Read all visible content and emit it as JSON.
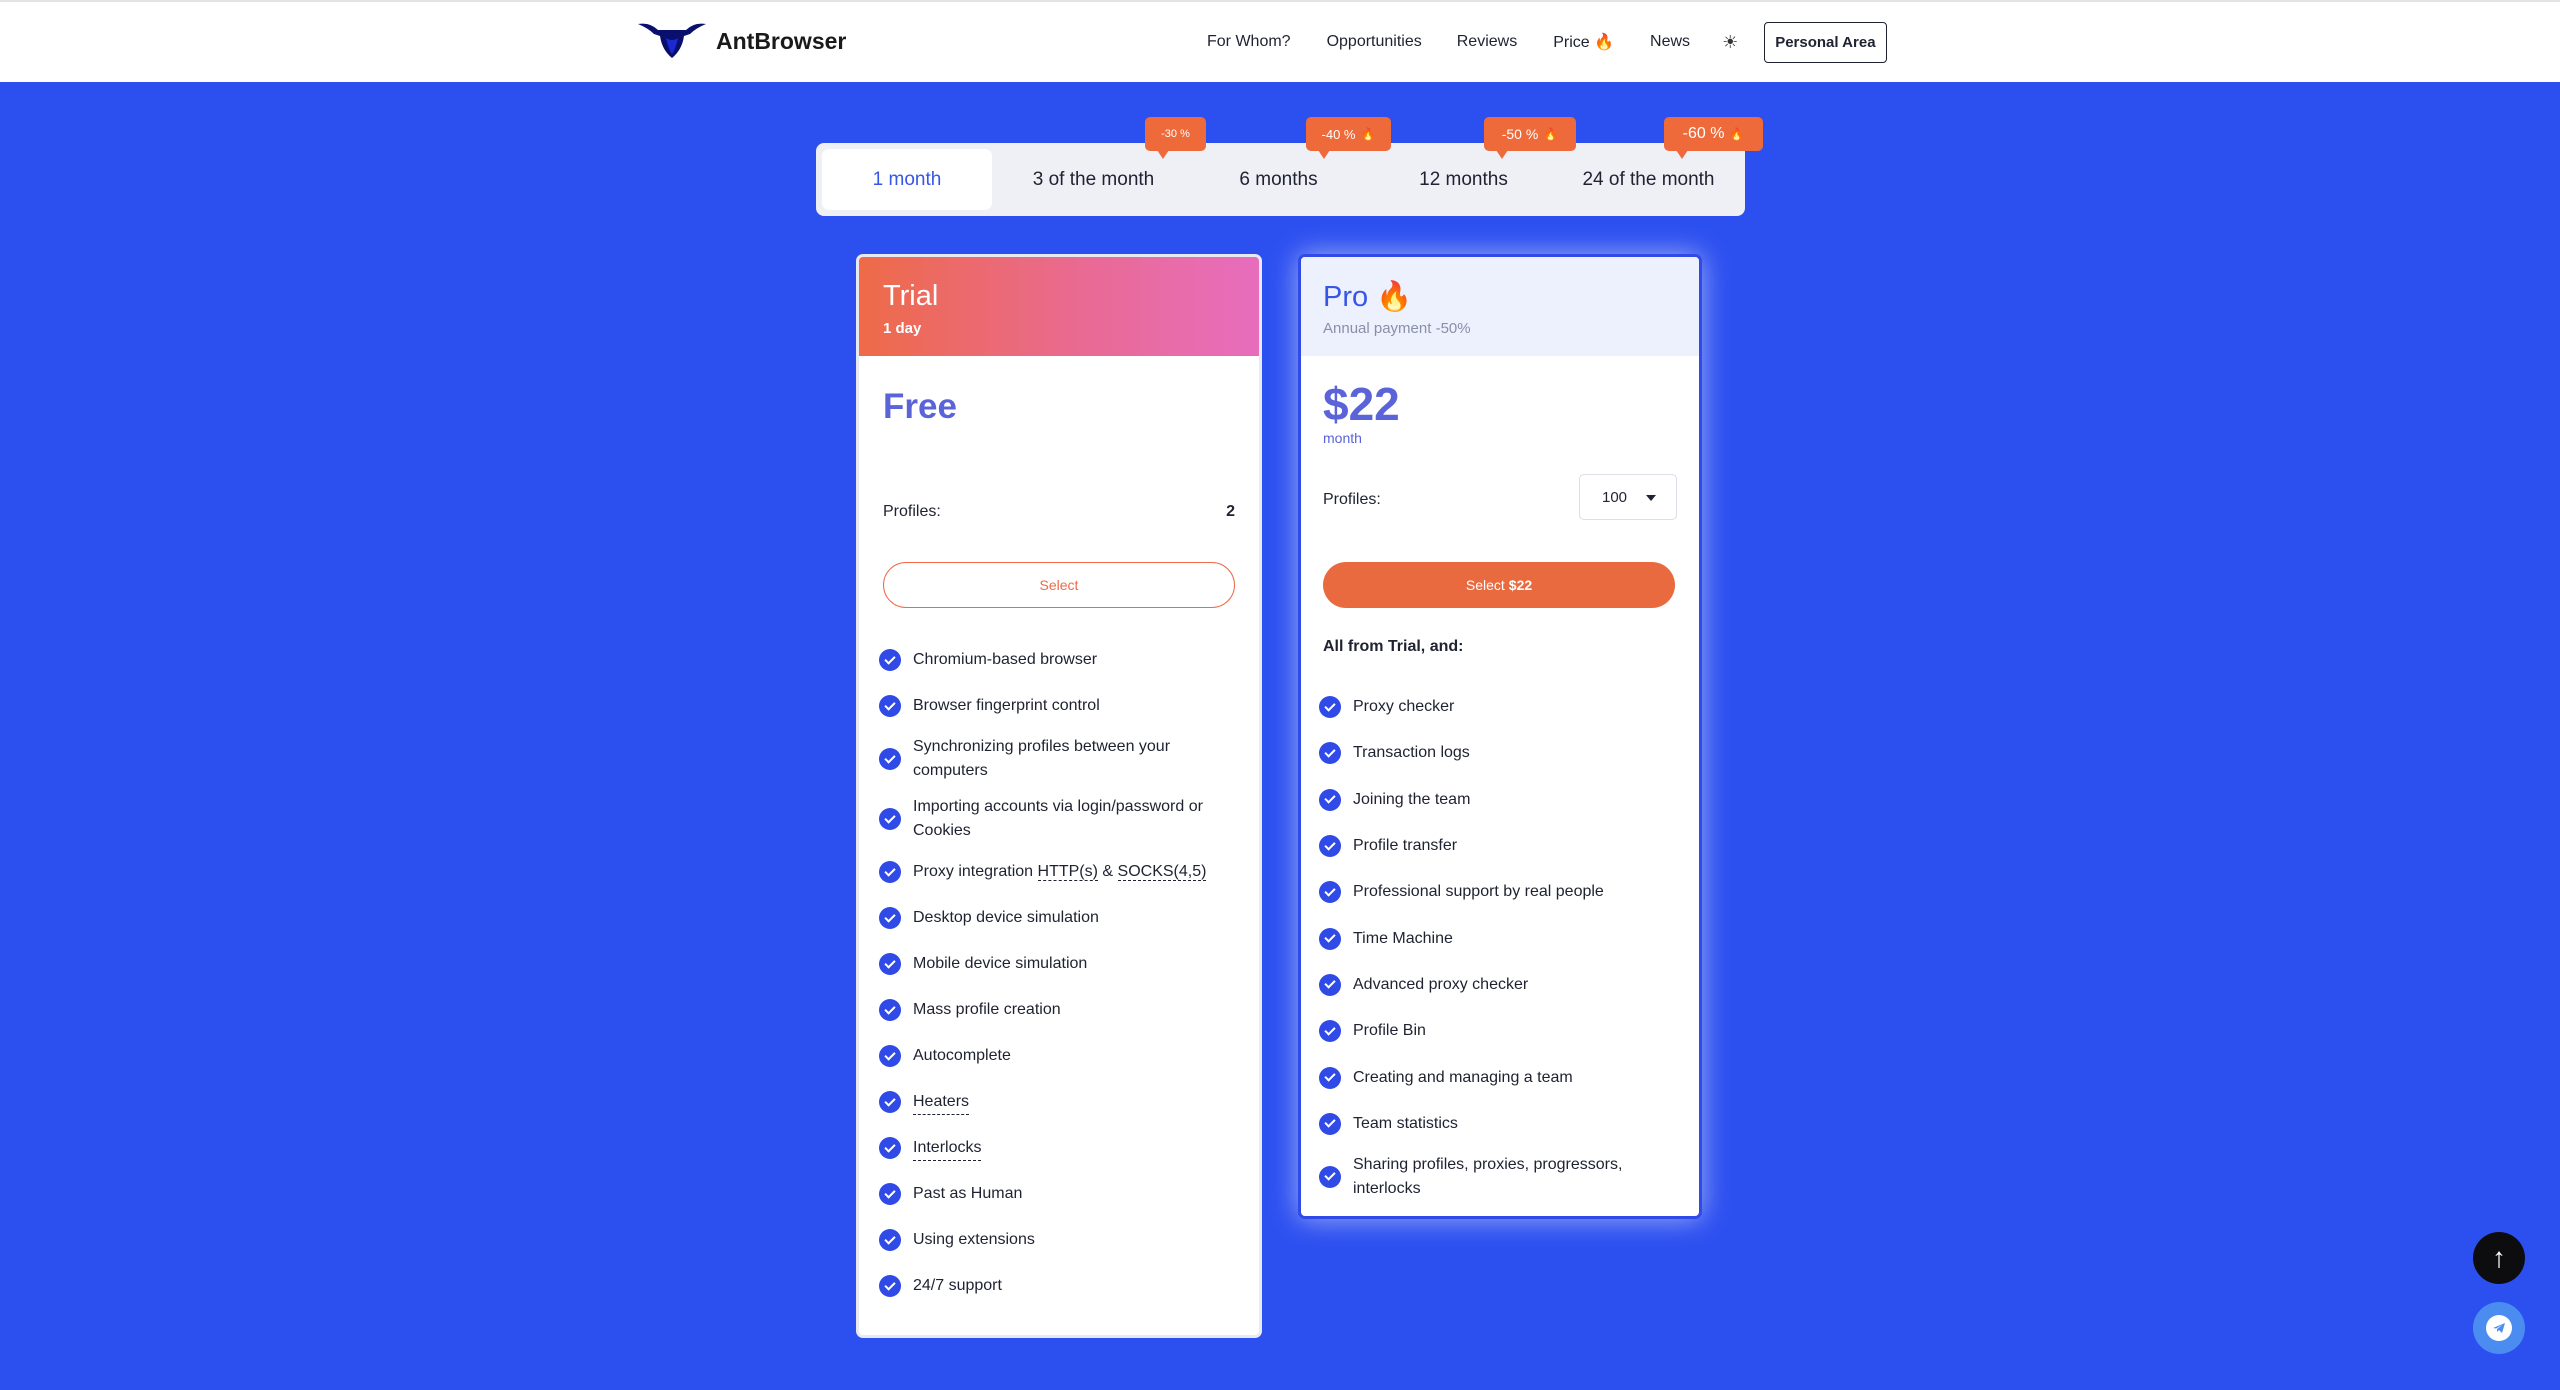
{
  "header": {
    "brand": "AntBrowser",
    "nav": [
      "For Whom?",
      "Opportunities",
      "Reviews",
      "Price 🔥",
      "News"
    ],
    "theme_icon": "sun-icon",
    "personal_area": "Personal Area"
  },
  "tabs": [
    {
      "label": "1 month",
      "badge": null
    },
    {
      "label": "3 of the month",
      "badge": "-30 %"
    },
    {
      "label": "6 months",
      "badge": "-40 %"
    },
    {
      "label": "12 months",
      "badge": "-50 %"
    },
    {
      "label": "24 of the month",
      "badge": "-60 %"
    }
  ],
  "active_tab": "1 month",
  "trial": {
    "name": "Trial",
    "duration": "1 day",
    "price": "Free",
    "profiles_label": "Profiles:",
    "profiles_value": "2",
    "select_label": "Select",
    "features": [
      "Chromium-based browser",
      "Browser fingerprint control",
      "Synchronizing profiles between your computers",
      "Importing accounts via login/password or Cookies",
      "Proxy integration",
      "Desktop device simulation",
      "Mobile device simulation",
      "Mass profile creation",
      "Autocomplete",
      "Heaters",
      "Interlocks",
      "Past as Human",
      "Using extensions",
      "24/7 support"
    ],
    "proxy_http": "HTTP(s)",
    "proxy_amp": "&",
    "proxy_socks": "SOCKS(4,5)"
  },
  "pro": {
    "name": "Pro 🔥",
    "subtitle": "Annual payment -50%",
    "price": "$22",
    "price_unit": "month",
    "profiles_label": "Profiles:",
    "profiles_value": "100",
    "select_label": "Select",
    "select_price": "$22",
    "all_from": "All from Trial, and:",
    "features": [
      "Proxy checker",
      "Transaction logs",
      "Joining the team",
      "Profile transfer",
      "Professional support by real people",
      "Time Machine",
      "Advanced proxy checker",
      "Profile Bin",
      "Creating and managing a team",
      "Team statistics",
      "Sharing profiles, proxies, progressors, interlocks"
    ]
  },
  "colors": {
    "background": "#2c4ff0",
    "accent": "#3856e6",
    "orange": "#ea6a3f",
    "check": "#2f4ae6"
  }
}
